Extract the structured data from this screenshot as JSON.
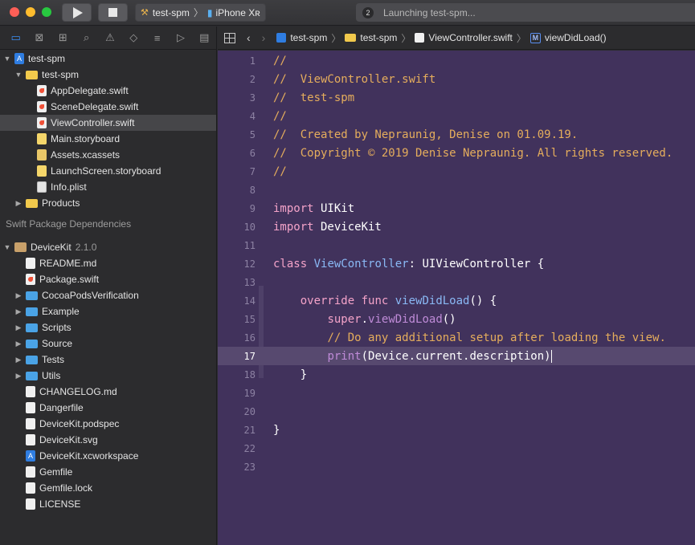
{
  "toolbar": {
    "scheme_target": "test-spm",
    "scheme_device": "iPhone Xʀ",
    "status_badge": "2",
    "status_text": "Launching test-spm..."
  },
  "nav_tabs": [
    "folder-icon",
    "source-control-icon",
    "symbol-icon",
    "search-icon",
    "warning-icon",
    "test-icon",
    "debug-icon",
    "breakpoint-icon",
    "report-icon"
  ],
  "tree": [
    {
      "label": "test-spm",
      "icon": "project",
      "indent": 0,
      "disclosure": "open"
    },
    {
      "label": "test-spm",
      "icon": "folder",
      "indent": 1,
      "disclosure": "open"
    },
    {
      "label": "AppDelegate.swift",
      "icon": "swift",
      "indent": 2,
      "disclosure": ""
    },
    {
      "label": "SceneDelegate.swift",
      "icon": "swift",
      "indent": 2,
      "disclosure": ""
    },
    {
      "label": "ViewController.swift",
      "icon": "swift",
      "indent": 2,
      "disclosure": "",
      "selected": true
    },
    {
      "label": "Main.storyboard",
      "icon": "storyboard",
      "indent": 2,
      "disclosure": ""
    },
    {
      "label": "Assets.xcassets",
      "icon": "assets",
      "indent": 2,
      "disclosure": ""
    },
    {
      "label": "LaunchScreen.storyboard",
      "icon": "storyboard",
      "indent": 2,
      "disclosure": ""
    },
    {
      "label": "Info.plist",
      "icon": "plist",
      "indent": 2,
      "disclosure": ""
    },
    {
      "label": "Products",
      "icon": "folder",
      "indent": 1,
      "disclosure": "closed"
    }
  ],
  "section_header": "Swift Package Dependencies",
  "package": {
    "label": "DeviceKit",
    "version": "2.1.0"
  },
  "package_tree": [
    {
      "label": "README.md",
      "icon": "doc",
      "indent": 1,
      "disclosure": ""
    },
    {
      "label": "Package.swift",
      "icon": "swift",
      "indent": 1,
      "disclosure": ""
    },
    {
      "label": "CocoaPodsVerification",
      "icon": "folder-blue",
      "indent": 1,
      "disclosure": "closed"
    },
    {
      "label": "Example",
      "icon": "folder-blue",
      "indent": 1,
      "disclosure": "closed"
    },
    {
      "label": "Scripts",
      "icon": "folder-blue",
      "indent": 1,
      "disclosure": "closed"
    },
    {
      "label": "Source",
      "icon": "folder-blue",
      "indent": 1,
      "disclosure": "closed"
    },
    {
      "label": "Tests",
      "icon": "folder-blue",
      "indent": 1,
      "disclosure": "closed"
    },
    {
      "label": "Utils",
      "icon": "folder-blue",
      "indent": 1,
      "disclosure": "closed"
    },
    {
      "label": "CHANGELOG.md",
      "icon": "doc",
      "indent": 1,
      "disclosure": ""
    },
    {
      "label": "Dangerfile",
      "icon": "doc",
      "indent": 1,
      "disclosure": ""
    },
    {
      "label": "DeviceKit.podspec",
      "icon": "doc",
      "indent": 1,
      "disclosure": ""
    },
    {
      "label": "DeviceKit.svg",
      "icon": "doc",
      "indent": 1,
      "disclosure": ""
    },
    {
      "label": "DeviceKit.xcworkspace",
      "icon": "project",
      "indent": 1,
      "disclosure": ""
    },
    {
      "label": "Gemfile",
      "icon": "doc",
      "indent": 1,
      "disclosure": ""
    },
    {
      "label": "Gemfile.lock",
      "icon": "doc",
      "indent": 1,
      "disclosure": ""
    },
    {
      "label": "LICENSE",
      "icon": "doc",
      "indent": 1,
      "disclosure": ""
    }
  ],
  "jumpbar": {
    "crumbs": [
      "test-spm",
      "test-spm",
      "ViewController.swift",
      "viewDidLoad()"
    ]
  },
  "editor": {
    "current_line": 17,
    "lines": [
      [
        [
          "c",
          "//"
        ]
      ],
      [
        [
          "c",
          "//  ViewController.swift"
        ]
      ],
      [
        [
          "c",
          "//  test-spm"
        ]
      ],
      [
        [
          "c",
          "//"
        ]
      ],
      [
        [
          "c",
          "//  Created by Nepraunig, Denise on 01.09.19."
        ]
      ],
      [
        [
          "c",
          "//  Copyright © 2019 Denise Nepraunig. All rights reserved."
        ]
      ],
      [
        [
          "c",
          "//"
        ]
      ],
      [],
      [
        [
          "k",
          "import"
        ],
        [
          "p",
          " UIKit"
        ]
      ],
      [
        [
          "k",
          "import"
        ],
        [
          "p",
          " DeviceKit"
        ]
      ],
      [],
      [
        [
          "k",
          "class"
        ],
        [
          "p",
          " "
        ],
        [
          "t",
          "ViewController"
        ],
        [
          "p",
          ": UIViewController {"
        ]
      ],
      [],
      [
        [
          "p",
          "    "
        ],
        [
          "k",
          "override"
        ],
        [
          "p",
          " "
        ],
        [
          "k",
          "func"
        ],
        [
          "p",
          " "
        ],
        [
          "t",
          "viewDidLoad"
        ],
        [
          "p",
          "() {"
        ]
      ],
      [
        [
          "p",
          "        "
        ],
        [
          "k",
          "super"
        ],
        [
          "p",
          "."
        ],
        [
          "f",
          "viewDidLoad"
        ],
        [
          "p",
          "()"
        ]
      ],
      [
        [
          "p",
          "        "
        ],
        [
          "c",
          "// Do any additional setup after loading the view."
        ]
      ],
      [
        [
          "p",
          "        "
        ],
        [
          "f",
          "print"
        ],
        [
          "p",
          "(Device.current.description)"
        ]
      ],
      [
        [
          "p",
          "    }"
        ]
      ],
      [],
      [],
      [
        [
          "p",
          "}"
        ]
      ],
      [],
      []
    ]
  }
}
